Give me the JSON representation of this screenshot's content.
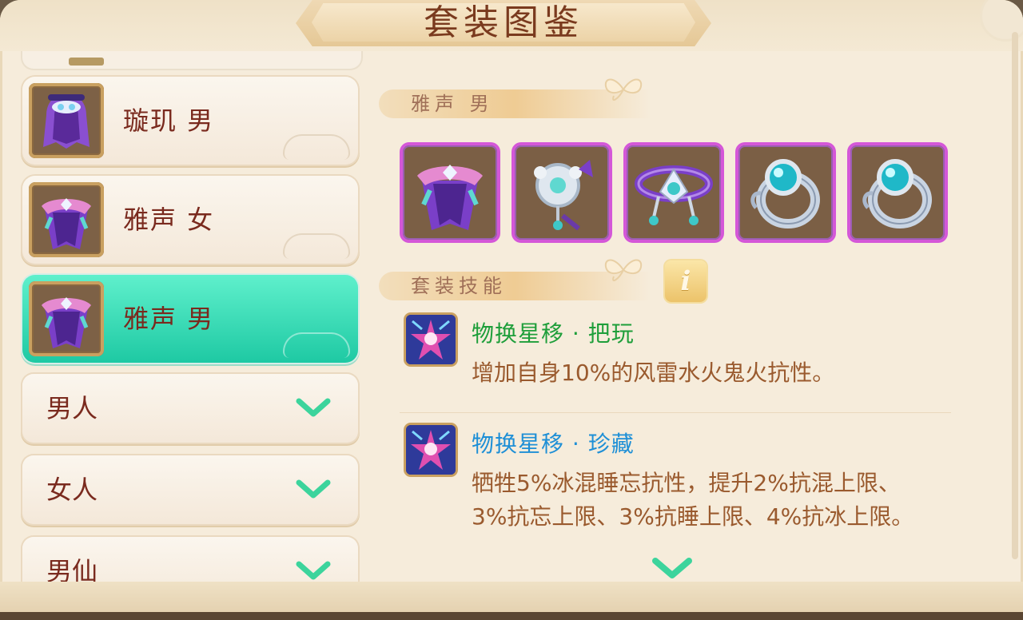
{
  "window": {
    "title": "套装图鉴"
  },
  "left_list": {
    "suits": [
      {
        "label": "璇玑 男",
        "icon": "purple-hood-icon",
        "selected": false
      },
      {
        "label": "雅声 女",
        "icon": "violet-cape-icon",
        "selected": false
      },
      {
        "label": "雅声 男",
        "icon": "violet-cape-icon",
        "selected": true
      }
    ],
    "categories": [
      {
        "label": "男人"
      },
      {
        "label": "女人"
      },
      {
        "label": "男仙"
      }
    ]
  },
  "detail": {
    "suit_title": "雅声  男",
    "equipment_icons": [
      "violet-cape-icon",
      "silver-pendant-icon",
      "crystal-tiara-icon",
      "turquoise-ring-icon",
      "turquoise-ring-icon"
    ],
    "skills_header": "套装技能",
    "info_button": "i",
    "skills": [
      {
        "name": "物换星移 · 把玩",
        "name_color": "#1e9e3a",
        "description": "增加自身10%的风雷水火鬼火抗性。",
        "icon": "star-skill-icon"
      },
      {
        "name": "物换星移 · 珍藏",
        "name_color": "#1e8fd6",
        "description": "牺牲5%冰混睡忘抗性，提升2%抗混上限、3%抗忘上限、3%抗睡上限、4%抗冰上限。",
        "icon": "star-skill-icon"
      }
    ]
  },
  "colors": {
    "accent": "#1ec9a3",
    "title_text": "#7a3a1e",
    "frame_bg": "#f6ecdb"
  }
}
